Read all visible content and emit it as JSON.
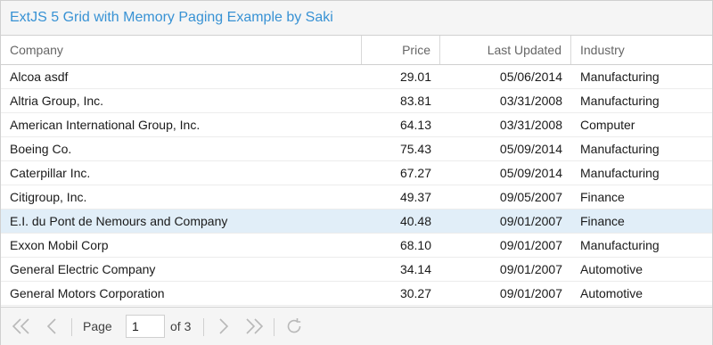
{
  "panel": {
    "title": "ExtJS 5 Grid with Memory Paging Example by Saki"
  },
  "columns": {
    "company": "Company",
    "price": "Price",
    "last_updated": "Last Updated",
    "industry": "Industry"
  },
  "rows": [
    {
      "company": "Alcoa asdf",
      "price": "29.01",
      "last_updated": "05/06/2014",
      "industry": "Manufacturing"
    },
    {
      "company": "Altria Group, Inc.",
      "price": "83.81",
      "last_updated": "03/31/2008",
      "industry": "Manufacturing"
    },
    {
      "company": "American International Group, Inc.",
      "price": "64.13",
      "last_updated": "03/31/2008",
      "industry": "Computer"
    },
    {
      "company": "Boeing Co.",
      "price": "75.43",
      "last_updated": "05/09/2014",
      "industry": "Manufacturing"
    },
    {
      "company": "Caterpillar Inc.",
      "price": "67.27",
      "last_updated": "05/09/2014",
      "industry": "Manufacturing"
    },
    {
      "company": "Citigroup, Inc.",
      "price": "49.37",
      "last_updated": "09/05/2007",
      "industry": "Finance"
    },
    {
      "company": "E.I. du Pont de Nemours and Company",
      "price": "40.48",
      "last_updated": "09/01/2007",
      "industry": "Finance",
      "selected": true
    },
    {
      "company": "Exxon Mobil Corp",
      "price": "68.10",
      "last_updated": "09/01/2007",
      "industry": "Manufacturing"
    },
    {
      "company": "General Electric Company",
      "price": "34.14",
      "last_updated": "09/01/2007",
      "industry": "Automotive"
    },
    {
      "company": "General Motors Corporation",
      "price": "30.27",
      "last_updated": "09/01/2007",
      "industry": "Automotive"
    }
  ],
  "paging": {
    "page_label": "Page",
    "current_page": "1",
    "of_label": "of 3",
    "icons": [
      "first-page-icon",
      "prev-page-icon",
      "next-page-icon",
      "last-page-icon",
      "refresh-icon"
    ]
  },
  "colors": {
    "title": "#3892d4",
    "selected_row": "#e1eef8",
    "icon": "#b8b8b8"
  }
}
